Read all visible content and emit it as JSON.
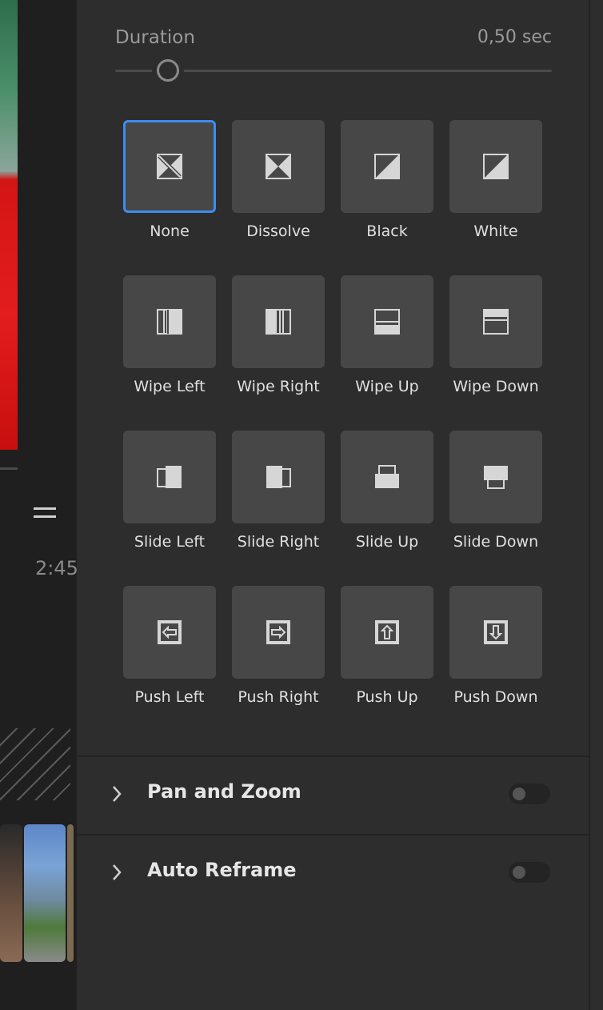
{
  "left": {
    "time_partial": "2:45"
  },
  "duration": {
    "label": "Duration",
    "value": "0,50 sec",
    "slider_fraction": 0.12
  },
  "transitions": [
    {
      "id": "none",
      "label": "None",
      "icon": "none-icon",
      "selected": true
    },
    {
      "id": "dissolve",
      "label": "Dissolve",
      "icon": "dissolve-icon"
    },
    {
      "id": "black",
      "label": "Black",
      "icon": "fade-black-icon"
    },
    {
      "id": "white",
      "label": "White",
      "icon": "fade-white-icon"
    },
    {
      "id": "wipe-left",
      "label": "Wipe Left",
      "icon": "wipe-left-icon"
    },
    {
      "id": "wipe-right",
      "label": "Wipe Right",
      "icon": "wipe-right-icon"
    },
    {
      "id": "wipe-up",
      "label": "Wipe Up",
      "icon": "wipe-up-icon"
    },
    {
      "id": "wipe-down",
      "label": "Wipe Down",
      "icon": "wipe-down-icon"
    },
    {
      "id": "slide-left",
      "label": "Slide Left",
      "icon": "slide-left-icon"
    },
    {
      "id": "slide-right",
      "label": "Slide Right",
      "icon": "slide-right-icon"
    },
    {
      "id": "slide-up",
      "label": "Slide Up",
      "icon": "slide-up-icon"
    },
    {
      "id": "slide-down",
      "label": "Slide Down",
      "icon": "slide-down-icon"
    },
    {
      "id": "push-left",
      "label": "Push Left",
      "icon": "push-left-icon"
    },
    {
      "id": "push-right",
      "label": "Push Right",
      "icon": "push-right-icon"
    },
    {
      "id": "push-up",
      "label": "Push Up",
      "icon": "push-up-icon"
    },
    {
      "id": "push-down",
      "label": "Push Down",
      "icon": "push-down-icon"
    }
  ],
  "sections": [
    {
      "title": "Pan and Zoom",
      "enabled": false
    },
    {
      "title": "Auto Reframe",
      "enabled": false
    }
  ],
  "colors": {
    "accent": "#3d8cf0",
    "tile": "#474747",
    "panel": "#2d2d2d"
  }
}
